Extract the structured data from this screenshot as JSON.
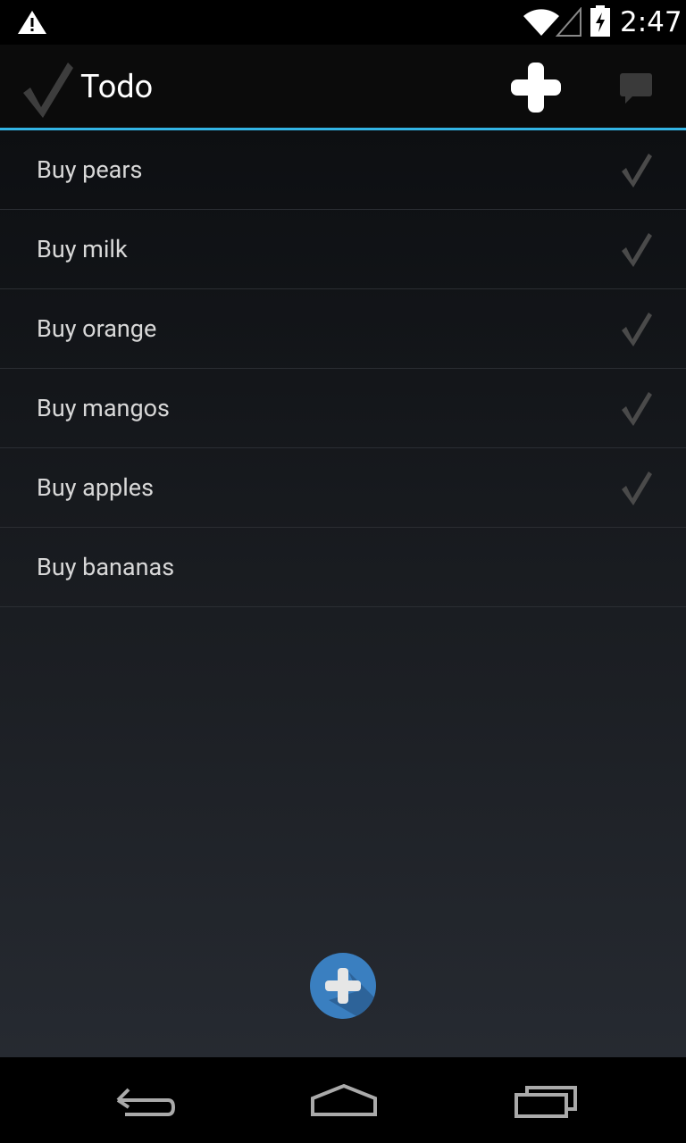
{
  "status_bar": {
    "time": "2:47",
    "icons": [
      "warning-icon",
      "wifi-icon",
      "signal-icon",
      "battery-charging-icon"
    ]
  },
  "action_bar": {
    "title": "Todo",
    "app_icon": "checkmark-icon",
    "actions": [
      "add-icon",
      "message-icon"
    ]
  },
  "todos": [
    {
      "label": "Buy pears",
      "done": true
    },
    {
      "label": "Buy milk",
      "done": true
    },
    {
      "label": "Buy orange",
      "done": true
    },
    {
      "label": "Buy mangos",
      "done": true
    },
    {
      "label": "Buy apples",
      "done": true
    },
    {
      "label": "Buy bananas",
      "done": false
    }
  ],
  "fab_icon": "add-circle-icon",
  "nav_bar": [
    "back-icon",
    "home-icon",
    "recents-icon"
  ],
  "colors": {
    "accent": "#33b5e5",
    "fab": "#3a7fc0"
  }
}
